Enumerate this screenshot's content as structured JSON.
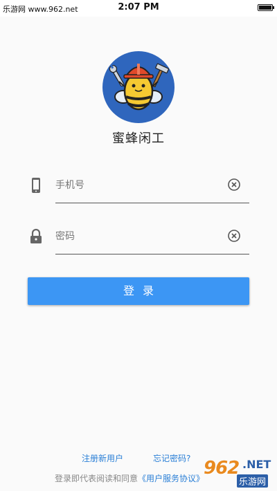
{
  "status_bar": {
    "carrier": "乐游网 www.962.net",
    "time": "2:07 PM",
    "battery_icon": "battery-full-icon"
  },
  "app": {
    "name": "蜜蜂闲工",
    "logo_icon": "bee-worker-logo"
  },
  "form": {
    "phone": {
      "placeholder": "手机号",
      "value": "",
      "icon": "phone-icon",
      "clear_icon": "clear-circle-icon"
    },
    "password": {
      "placeholder": "密码",
      "value": "",
      "icon": "lock-icon",
      "clear_icon": "clear-circle-icon"
    },
    "login_label": "登录"
  },
  "links": {
    "register": "注册新用户",
    "forgot": "忘记密码?"
  },
  "agreement": {
    "prefix": "登录即代表阅读和同意",
    "terms": "《用户服务协议》"
  },
  "watermark": {
    "number": "962",
    "site": ".NET",
    "cn": "乐游网"
  },
  "colors": {
    "accent": "#3c96f4",
    "link": "#2a7fd6",
    "logo_bg": "#2f66bd"
  }
}
